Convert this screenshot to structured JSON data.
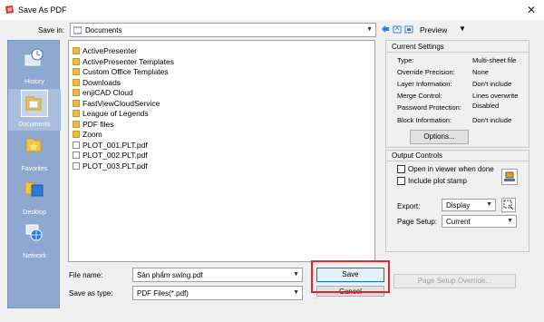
{
  "window": {
    "title": "Save As PDF",
    "close_glyph": "✕"
  },
  "save_in": {
    "label": "Save in:",
    "value": "Documents"
  },
  "toolbar": {
    "preview_label": "Preview"
  },
  "places": [
    {
      "label": "History",
      "icon": "history-icon"
    },
    {
      "label": "Documents",
      "icon": "documents-icon"
    },
    {
      "label": "Favorites",
      "icon": "favorites-icon"
    },
    {
      "label": "Desktop",
      "icon": "desktop-icon"
    },
    {
      "label": "Network",
      "icon": "network-icon"
    }
  ],
  "files": [
    {
      "name": "ActivePresenter",
      "type": "folder"
    },
    {
      "name": "ActivePresenter Templates",
      "type": "folder"
    },
    {
      "name": "Custom Office Templates",
      "type": "folder"
    },
    {
      "name": "Downloads",
      "type": "folder"
    },
    {
      "name": "enjiCAD Cloud",
      "type": "folder"
    },
    {
      "name": "FastViewCloudService",
      "type": "folder"
    },
    {
      "name": "League of Legends",
      "type": "folder"
    },
    {
      "name": "PDF files",
      "type": "folder"
    },
    {
      "name": "Zoom",
      "type": "folder"
    },
    {
      "name": "PLOT_001.PLT.pdf",
      "type": "pdf"
    },
    {
      "name": "PLOT_002.PLT.pdf",
      "type": "pdf"
    },
    {
      "name": "PLOT_003.PLT.pdf",
      "type": "pdf"
    }
  ],
  "current_settings": {
    "title": "Current Settings",
    "rows": [
      {
        "key": "Type:",
        "value": "Multi-sheet file"
      },
      {
        "key": "Override Precision:",
        "value": "None"
      },
      {
        "key": "Layer Information:",
        "value": "Don't include"
      },
      {
        "key": "Merge Control:",
        "value": "Lines overwrite"
      },
      {
        "key": "Password Protection:",
        "value": "Disabled"
      },
      {
        "key": "Block Information:",
        "value": "Don't include"
      }
    ],
    "options_button": "Options..."
  },
  "output_controls": {
    "title": "Output Controls",
    "open_in_viewer": "Open in viewer when done",
    "include_plot_stamp": "Include plot stamp",
    "export_label": "Export:",
    "export_value": "Display",
    "page_setup_label": "Page Setup:",
    "page_setup_value": "Current",
    "page_setup_override_button": "Page Setup Override..."
  },
  "file_name": {
    "label": "File name:",
    "value": "Sản phẩm swing.pdf"
  },
  "save_as_type": {
    "label": "Save as type:",
    "value": "PDF Files(*.pdf)"
  },
  "buttons": {
    "save": "Save",
    "cancel": "Cancel"
  },
  "colors": {
    "highlight": "#e32626",
    "places_bg": "#8fa8cf",
    "folder": "#e9b84a"
  }
}
